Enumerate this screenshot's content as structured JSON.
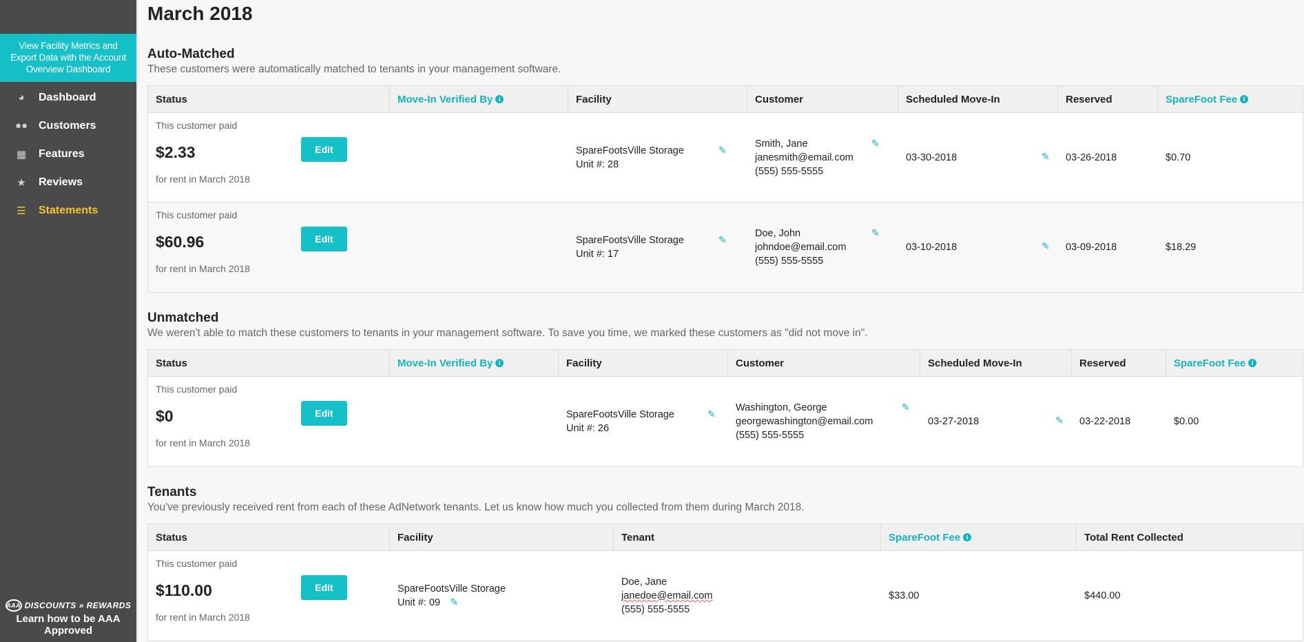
{
  "sidebar": {
    "promo": "View Facility Metrics and Export Data with the Account Overview Dashboard",
    "items": [
      {
        "label": "Dashboard",
        "icon": "dashboard-icon",
        "active": false
      },
      {
        "label": "Customers",
        "icon": "users-icon",
        "active": false
      },
      {
        "label": "Features",
        "icon": "building-icon",
        "active": false
      },
      {
        "label": "Reviews",
        "icon": "star-icon",
        "active": false
      },
      {
        "label": "Statements",
        "icon": "list-icon",
        "active": true
      }
    ],
    "aaa_logo": "AAA",
    "aaa_brand": "DISCOUNTS » REWARDS",
    "aaa_cta": "Learn how to be AAA Approved"
  },
  "page": {
    "month": "March 2018"
  },
  "common": {
    "paid_label": "This customer paid",
    "rent_note": "for rent in March 2018",
    "edit": "Edit"
  },
  "auto": {
    "title": "Auto-Matched",
    "desc": "These customers were automatically matched to tenants in your management software.",
    "headers": [
      "Status",
      "Move-In Verified By",
      "Facility",
      "Customer",
      "Scheduled Move-In",
      "Reserved",
      "SpareFoot Fee"
    ],
    "rows": [
      {
        "amount": "$2.33",
        "facility": "SpareFootsVille Storage",
        "unit": "Unit #: 28",
        "name": "Smith, Jane",
        "email": "janesmith@email.com",
        "phone": "(555) 555-5555",
        "movein": "03-30-2018",
        "reserved": "03-26-2018",
        "fee": "$0.70"
      },
      {
        "amount": "$60.96",
        "facility": "SpareFootsVille Storage",
        "unit": "Unit #: 17",
        "name": "Doe, John",
        "email": "johndoe@email.com",
        "phone": "(555) 555-5555",
        "movein": "03-10-2018",
        "reserved": "03-09-2018",
        "fee": "$18.29"
      }
    ]
  },
  "unmatched": {
    "title": "Unmatched",
    "desc": "We weren't able to match these customers to tenants in your management software. To save you time, we marked these customers as \"did not move in\".",
    "headers": [
      "Status",
      "Move-In Verified By",
      "Facility",
      "Customer",
      "Scheduled Move-In",
      "Reserved",
      "SpareFoot Fee"
    ],
    "rows": [
      {
        "amount": "$0",
        "facility": "SpareFootsVille Storage",
        "unit": "Unit #: 26",
        "name": "Washington, George",
        "email": "georgewashington@email.com",
        "phone": "(555) 555-5555",
        "movein": "03-27-2018",
        "reserved": "03-22-2018",
        "fee": "$0.00"
      }
    ]
  },
  "tenants": {
    "title": "Tenants",
    "desc": "You've previously received rent from each of these AdNetwork tenants. Let us know how much you collected from them during March 2018.",
    "headers": [
      "Status",
      "Facility",
      "Tenant",
      "SpareFoot Fee",
      "Total Rent Collected"
    ],
    "rows": [
      {
        "amount": "$110.00",
        "facility": "SpareFootsVille Storage",
        "unit": "Unit #: 09",
        "name": "Doe, Jane",
        "email": "janedoe@email.com",
        "phone": "(555) 555-5555",
        "fee": "$33.00",
        "total": "$440.00"
      }
    ]
  },
  "colors": {
    "accent": "#16c0c9",
    "sidebar": "#4a4a4a",
    "active": "#f4c430"
  }
}
